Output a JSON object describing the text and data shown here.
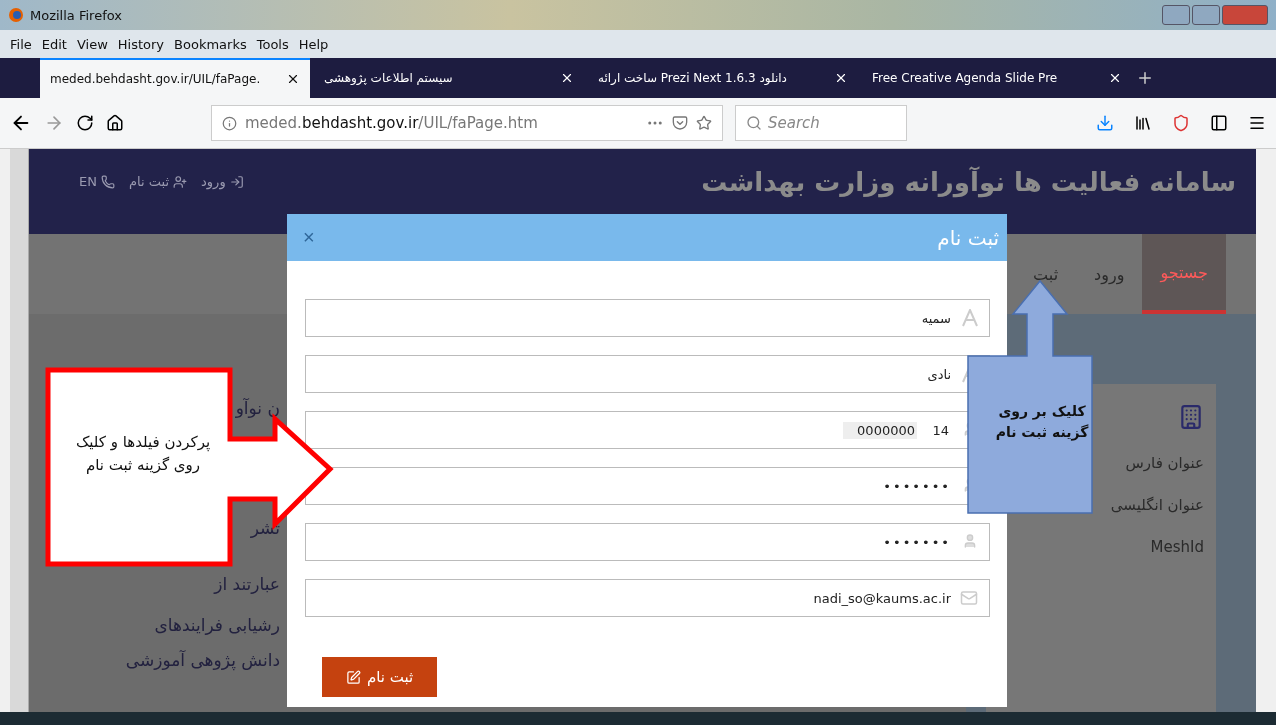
{
  "window": {
    "title": "Mozilla Firefox"
  },
  "menu": {
    "file": "File",
    "edit": "Edit",
    "view": "View",
    "history": "History",
    "bookmarks": "Bookmarks",
    "tools": "Tools",
    "help": "Help"
  },
  "tabs": {
    "tab_1": {
      "label": "meded.behdasht.gov.ir/UIL/faPage.",
      "selected": true
    },
    "tab_2": {
      "label": "سیستم اطلاعات پژوهشی",
      "selected": false
    },
    "tab_3": {
      "label": "دانلود Prezi Next 1.6.3 ساخت ارائه",
      "selected": false
    },
    "tab_4": {
      "label": "Free Creative Agenda Slide Pre",
      "selected": false
    }
  },
  "address": {
    "host_start": "meded.",
    "host": "behdasht.gov.ir",
    "path": "/UIL/faPage.htm"
  },
  "search": {
    "placeholder": "Search"
  },
  "site": {
    "title": "سامانه فعالیت ها نوآورانه وزارت بهداشت",
    "top_links": [
      "ورود",
      "ثبت نام",
      "EN"
    ],
    "nav": [
      {
        "label": "جستجو",
        "selected": true
      },
      {
        "label": "ورود",
        "selected": false
      },
      {
        "label": "ثبت",
        "selected": false
      }
    ],
    "article_lines": [
      "ن نوآو",
      "تشر",
      "عبارتند از",
      "رشیابی فرایندهای",
      "دانش پژوهی آموزشی"
    ],
    "side_labels": [
      "عنوان فارس",
      "عنوان انگلیسی",
      "MeshId"
    ]
  },
  "modal": {
    "title": "ثبت نام",
    "close": "×",
    "fields": [
      {
        "kind": "name",
        "value": "سمیه"
      },
      {
        "kind": "name",
        "value": "نادی"
      },
      {
        "kind": "phone",
        "prefix": "14",
        "value": "0000000"
      },
      {
        "kind": "password",
        "value": "•••••••"
      },
      {
        "kind": "password",
        "value": "•••••••"
      },
      {
        "kind": "email",
        "value": "nadi_so@kaums.ac.ir"
      }
    ],
    "submit": "ثبت نام"
  },
  "callouts": [
    {
      "kind": "right_arrow",
      "text": "پرکردن فیلدها و کلیک روی گزینه ثبت نام"
    },
    {
      "kind": "up_arrow",
      "text": "کلیک بر روی گزینه ثبت نام"
    }
  ]
}
